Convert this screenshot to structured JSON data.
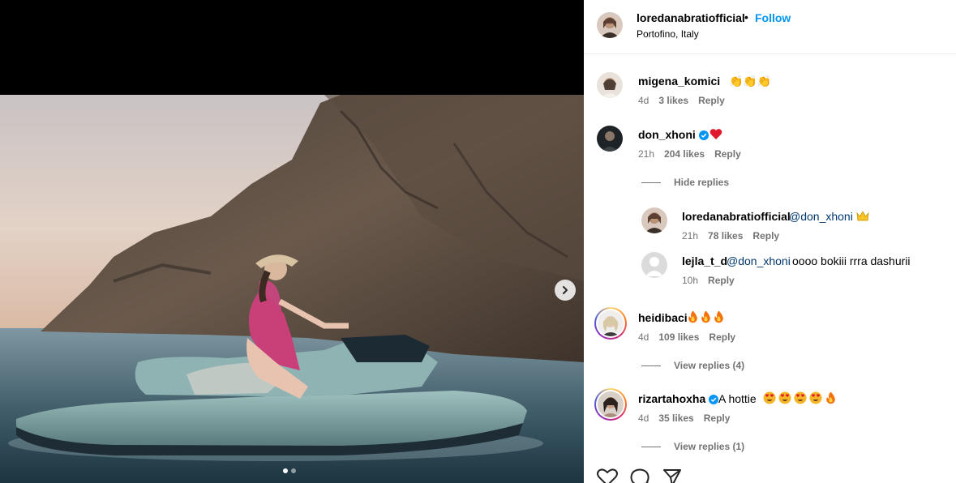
{
  "post": {
    "owner": "loredanabratiofficial",
    "follow_label": "Follow",
    "separator": "•",
    "location": "Portofino, Italy",
    "carousel": {
      "current_index": 1,
      "total": 2
    }
  },
  "comments": [
    {
      "user": "migena_komici",
      "text": "👏👏👏",
      "age": "4d",
      "likes": "3 likes",
      "reply_label": "Reply",
      "verified": false
    },
    {
      "user": "don_xhoni",
      "text": "",
      "age": "21h",
      "likes": "204 likes",
      "reply_label": "Reply",
      "verified": true,
      "thread_toggle": "Hide replies",
      "replies": [
        {
          "user": "loredanabratiofficial",
          "mention": "@don_xhoni",
          "text": "",
          "age": "21h",
          "likes": "78 likes",
          "reply_label": "Reply"
        },
        {
          "user": "lejla_t_d",
          "mention": "@don_xhoni",
          "text": "oooo bokiii rrra dashurii",
          "age": "10h",
          "reply_label": "Reply"
        }
      ]
    },
    {
      "user": "heidibaci",
      "text": "",
      "age": "4d",
      "likes": "109 likes",
      "reply_label": "Reply",
      "verified": false,
      "thread_toggle": "View replies (4)"
    },
    {
      "user": "rizartahoxha",
      "text": "A hottie",
      "age": "4d",
      "likes": "35 likes",
      "reply_label": "Reply",
      "verified": true,
      "thread_toggle": "View replies (1)"
    }
  ],
  "icons": {
    "verified": "verified-badge-icon",
    "heart": "red-heart-emoji",
    "fire": "fire-emoji",
    "star_eyes": "heart-eyes-emoji",
    "crown": "crown-emoji",
    "like": "heart-outline-icon",
    "comment": "comment-icon",
    "share": "share-icon",
    "next": "chevron-right-icon"
  },
  "colors": {
    "accent": "#0095f6",
    "mention": "#00376b",
    "meta": "#737373",
    "verified": "#0095f6"
  }
}
